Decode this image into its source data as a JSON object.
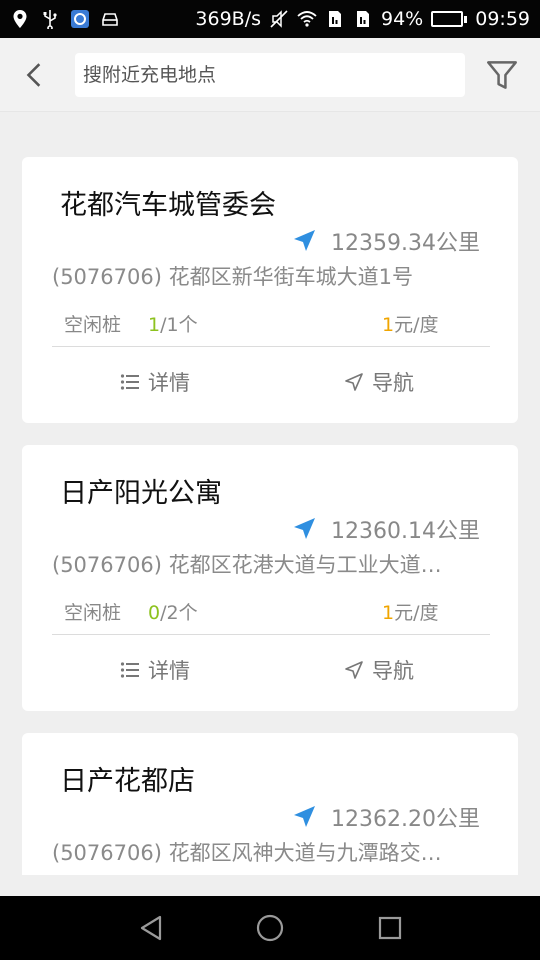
{
  "status_bar": {
    "left_icons": [
      "location-icon",
      "usb-icon",
      "app-notification-icon",
      "car-icon"
    ],
    "net_speed": "369B/s",
    "battery_percent": "94%",
    "battery_level": 0.94,
    "time": "09:59"
  },
  "header": {
    "search_placeholder": "搜附近充电地点"
  },
  "stations": [
    {
      "name": "花都汽车城管委会",
      "distance": "12359.34公里",
      "address": "(5076706) 花都区新华街车城大道1号",
      "idle_label": "空闲桩",
      "idle_available": "1",
      "idle_total": "/1个",
      "price_num": "1",
      "price_unit": "元/度",
      "detail_label": "详情",
      "nav_label": "导航"
    },
    {
      "name": "日产阳光公寓",
      "distance": "12360.14公里",
      "address": "(5076706) 花都区花港大道与工业大道…",
      "idle_label": "空闲桩",
      "idle_available": "0",
      "idle_total": "/2个",
      "price_num": "1",
      "price_unit": "元/度",
      "detail_label": "详情",
      "nav_label": "导航"
    },
    {
      "name": "日产花都店",
      "distance": "12362.20公里",
      "address": "(5076706) 花都区风神大道与九潭路交…",
      "idle_label": "",
      "idle_available": "",
      "idle_total": "",
      "price_num": "",
      "price_unit": "",
      "detail_label": "",
      "nav_label": ""
    }
  ],
  "colors": {
    "accent_blue": "#2f8fe0",
    "idle_green": "#8dc21f",
    "price_orange": "#f0a500"
  }
}
